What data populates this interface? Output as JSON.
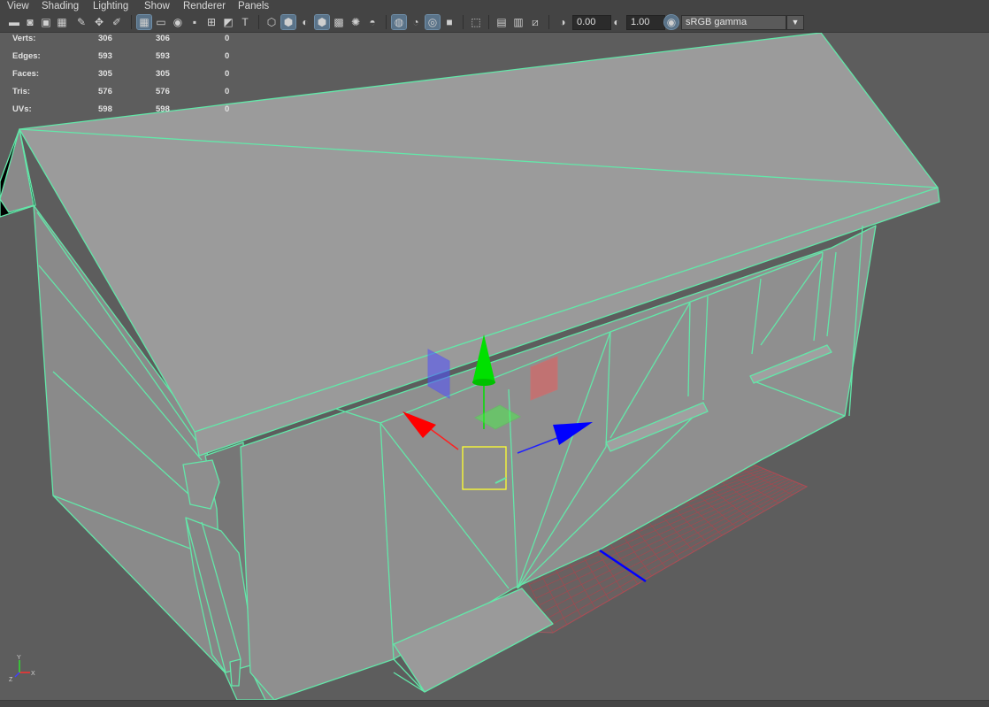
{
  "menu": [
    "View",
    "Shading",
    "Lighting",
    "Show",
    "Renderer",
    "Panels"
  ],
  "toolbar": {
    "icons": [
      "camera-icon",
      "camera-attributes-icon",
      "bookmark-icon",
      "image-plane-icon",
      "grease-pencil-icon",
      "2d-pan-zoom-icon",
      "brush-icon",
      "grid-icon",
      "film-gate-icon",
      "resolution-gate-icon",
      "gate-mask-icon",
      "field-chart-icon",
      "safe-action-icon",
      "safe-title-icon",
      "wireframe-icon",
      "smooth-shade-icon",
      "default-material-icon",
      "wireframe-on-shaded-icon",
      "textured-icon",
      "use-all-lights-icon",
      "shadows-icon",
      "screen-space-ao-icon",
      "motion-blur-icon",
      "multisample-aa-icon",
      "depth-of-field-icon",
      "isolate-select-icon",
      "xray-icon",
      "xray-active-components-icon",
      "xray-joints-icon",
      "exposure-icon",
      "gamma-icon",
      "color-management-icon"
    ],
    "exposure_value": "0.00",
    "gamma_value": "1.00",
    "view_transform": "sRGB gamma"
  },
  "hud": {
    "rows": [
      {
        "label": "Verts:",
        "a": "306",
        "b": "306",
        "c": "0"
      },
      {
        "label": "Edges:",
        "a": "593",
        "b": "593",
        "c": "0"
      },
      {
        "label": "Faces:",
        "a": "305",
        "b": "305",
        "c": "0"
      },
      {
        "label": "Tris:",
        "a": "576",
        "b": "576",
        "c": "0"
      },
      {
        "label": "UVs:",
        "a": "598",
        "b": "598",
        "c": "0"
      }
    ]
  },
  "axis_indicator": {
    "x": "X",
    "y": "Y",
    "z": "Z"
  },
  "colors": {
    "wire": "#63e7a9",
    "grid": "#b8404a",
    "gizmo_x": "#ff0000",
    "gizmo_y": "#00e000",
    "gizmo_z": "#0000ff"
  }
}
